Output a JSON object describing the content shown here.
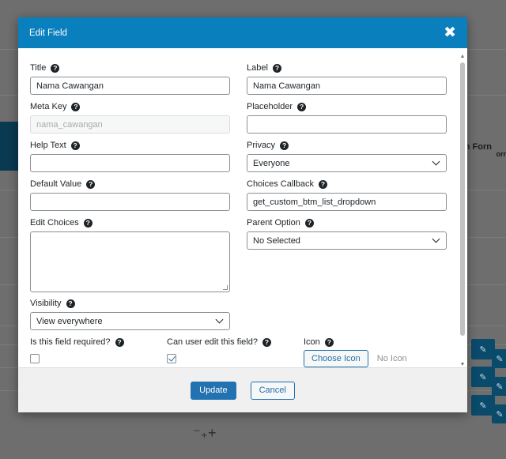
{
  "background": {
    "partial_text": "n Forn",
    "partial_text2": "orr"
  },
  "modal": {
    "title": "Edit Field",
    "close_symbol": "✖"
  },
  "fields": {
    "title": {
      "label": "Title",
      "value": "Nama Cawangan"
    },
    "label": {
      "label": "Label",
      "value": "Nama Cawangan"
    },
    "meta_key": {
      "label": "Meta Key",
      "placeholder": "nama_cawangan"
    },
    "placeholder": {
      "label": "Placeholder",
      "value": ""
    },
    "help_text": {
      "label": "Help Text",
      "value": ""
    },
    "privacy": {
      "label": "Privacy",
      "selected": "Everyone"
    },
    "default_value": {
      "label": "Default Value",
      "value": ""
    },
    "choices_callback": {
      "label": "Choices Callback",
      "value": "get_custom_btm_list_dropdown"
    },
    "edit_choices": {
      "label": "Edit Choices",
      "value": ""
    },
    "parent_option": {
      "label": "Parent Option",
      "selected": "No Selected"
    },
    "visibility": {
      "label": "Visibility",
      "selected": "View everywhere"
    },
    "required": {
      "label": "Is this field required?",
      "checked": false
    },
    "user_edit": {
      "label": "Can user edit this field?",
      "checked": true
    },
    "icon": {
      "label": "Icon",
      "button": "Choose Icon",
      "status": "No Icon"
    }
  },
  "help_symbol": "?",
  "footer": {
    "update_label": "Update",
    "cancel_label": "Cancel"
  },
  "colors": {
    "header": "#0a7fbd",
    "primary": "#2271b1"
  }
}
